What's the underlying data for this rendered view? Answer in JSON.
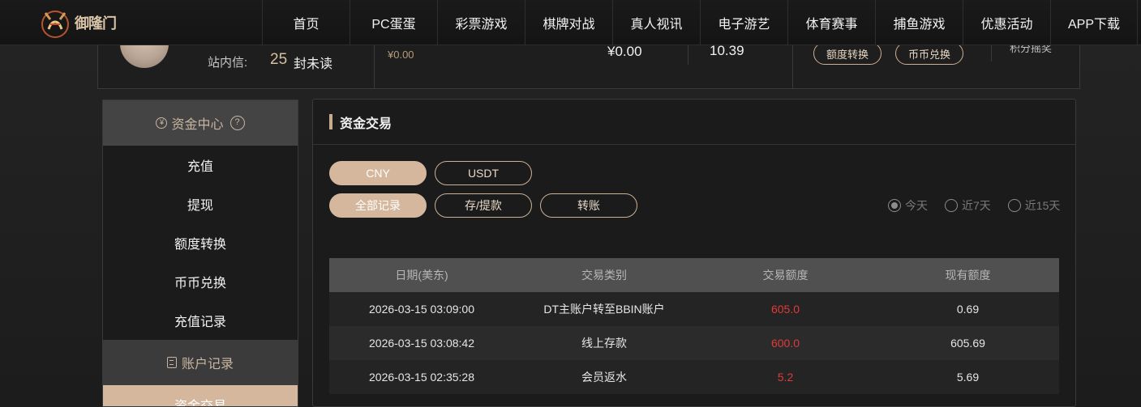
{
  "brand": {
    "logo_text": "御隆门"
  },
  "nav": [
    "首页",
    "PC蛋蛋",
    "彩票游戏",
    "棋牌对战",
    "真人视讯",
    "电子游艺",
    "体育赛事",
    "捕鱼游戏",
    "优惠活动",
    "APP下载"
  ],
  "profile": {
    "inbox_label": "站内信:",
    "inbox_count": "25",
    "inbox_unread": "封未读",
    "small_balance": "¥0.00",
    "balance_main": "¥0.00",
    "balance_other": "10.39",
    "btn_quota_transfer": "额度转换",
    "btn_coin_exchange": "币币兑换",
    "points_label": "积分摇奖"
  },
  "sidebar": {
    "fund_center": "资金中心",
    "help": "?",
    "fund_items": [
      "充值",
      "提现",
      "额度转换",
      "币币兑换",
      "充值记录"
    ],
    "account_records": "账户记录",
    "record_items": [
      "资金交易"
    ]
  },
  "panel": {
    "title": "资金交易",
    "currency_tabs": [
      "CNY",
      "USDT"
    ],
    "type_tabs": [
      "全部记录",
      "存/提款",
      "转账"
    ],
    "ranges": [
      "今天",
      "近7天",
      "近15天"
    ],
    "selected_range": "今天"
  },
  "table": {
    "columns": [
      "日期(美东)",
      "交易类别",
      "交易额度",
      "现有额度"
    ],
    "rows": [
      [
        "2026-03-15 03:09:00",
        "DT主账户转至BBIN账户",
        "605.0",
        "0.69"
      ],
      [
        "2026-03-15 03:08:42",
        "线上存款",
        "600.0",
        "605.69"
      ],
      [
        "2026-03-15 02:35:28",
        "会员返水",
        "5.2",
        "5.69"
      ]
    ]
  },
  "colors": {
    "accent": "#d4b79c",
    "amount": "#e03a3a",
    "bg": "#1f1f1f"
  }
}
